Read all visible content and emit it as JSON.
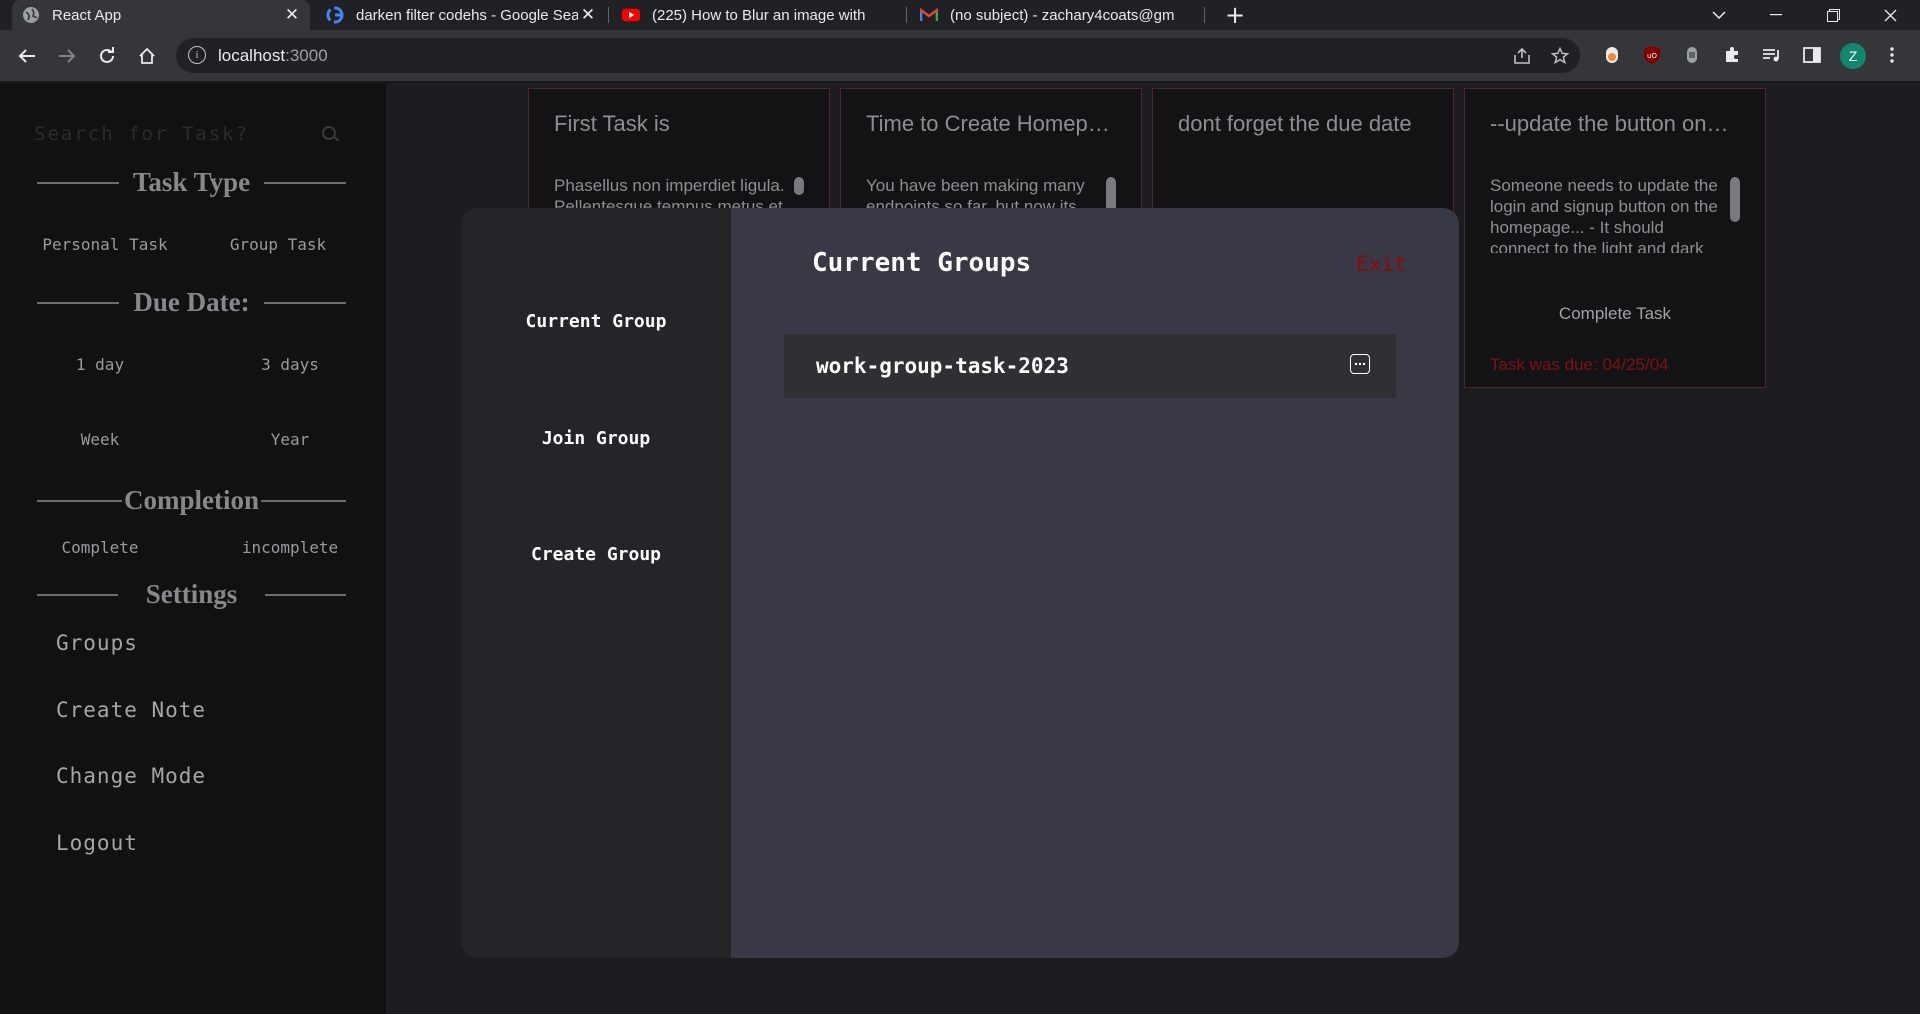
{
  "browser": {
    "tabs": [
      {
        "title": "React App",
        "icon": "globe-icon",
        "active": true
      },
      {
        "title": "darken filter codehs - Google Sea",
        "icon": "google-icon",
        "active": false
      },
      {
        "title": "(225) How to Blur an image with",
        "icon": "youtube-icon",
        "active": false
      },
      {
        "title": "(no subject) - zachary4coats@gm",
        "icon": "gmail-icon",
        "active": false
      }
    ],
    "close_glyph": "✕",
    "new_tab_glyph": "+",
    "url_host": "localhost",
    "url_port": ":3000",
    "profile_initial": "Z",
    "accent": "#12876f"
  },
  "sidebar": {
    "search_placeholder": "Search for Task?",
    "task_type": {
      "heading": "Task Type",
      "options": [
        "Personal Task",
        "Group Task"
      ]
    },
    "due_date": {
      "heading": "Due Date:",
      "options": [
        "1 day",
        "3 days",
        "Week",
        "Year"
      ]
    },
    "completion": {
      "heading": "Completion",
      "options": [
        "Complete",
        "incomplete"
      ]
    },
    "settings": {
      "heading": "Settings",
      "links": [
        "Groups",
        "Create Note",
        "Change Mode",
        "Logout"
      ]
    }
  },
  "tasks": [
    {
      "title": "First Task is",
      "body": "Phasellus non imperdiet ligula. Pellentesque tempus metus et"
    },
    {
      "title": "Time to Create Homep…",
      "body": "You have been making many endpoints so far, but now its"
    },
    {
      "title": "dont forget the due date",
      "body": ""
    },
    {
      "title": "--update the button on…",
      "body": "Someone needs to update the login and signup button on the homepage... - It should connect to the light and dark modes. The nav bar should fix",
      "complete_label": "Complete Task",
      "due_text": "Task was due: 04/25/04"
    }
  ],
  "modal": {
    "nav": [
      "Current Group",
      "Join Group",
      "Create Group"
    ],
    "title": "Current Groups",
    "exit_label": "Exit",
    "groups": [
      "work-group-task-2023"
    ],
    "exit_color": "#8b0a0a"
  }
}
